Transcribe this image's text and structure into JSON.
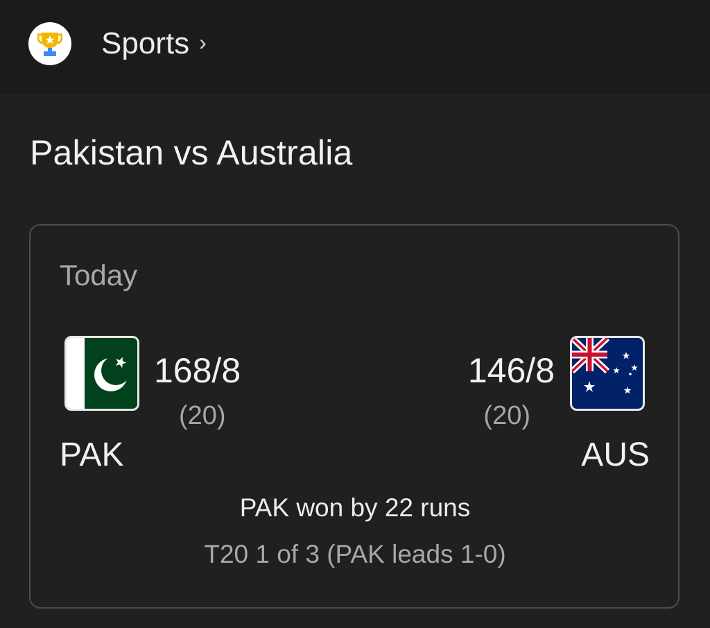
{
  "header": {
    "app_icon": "trophy-icon",
    "breadcrumb_label": "Sports",
    "chevron": "›"
  },
  "match": {
    "title": "Pakistan vs Australia",
    "date_label": "Today",
    "home": {
      "code": "PAK",
      "score": "168/8",
      "overs": "(20)",
      "flag_icon": "pakistan-flag-icon"
    },
    "away": {
      "code": "AUS",
      "score": "146/8",
      "overs": "(20)",
      "flag_icon": "australia-flag-icon"
    },
    "result": "PAK won by 22 runs",
    "series_info": "T20 1 of 3 (PAK leads 1-0)"
  },
  "colors": {
    "background": "#202020",
    "header_background": "#1b1b1b",
    "card_border": "#4a4d52",
    "primary_text": "#f2f2f2",
    "secondary_text": "#a8a8a8",
    "pakistan_green": "#01411c",
    "australia_blue": "#012169",
    "trophy_gold": "#f4b400",
    "trophy_blue": "#4285f4"
  }
}
